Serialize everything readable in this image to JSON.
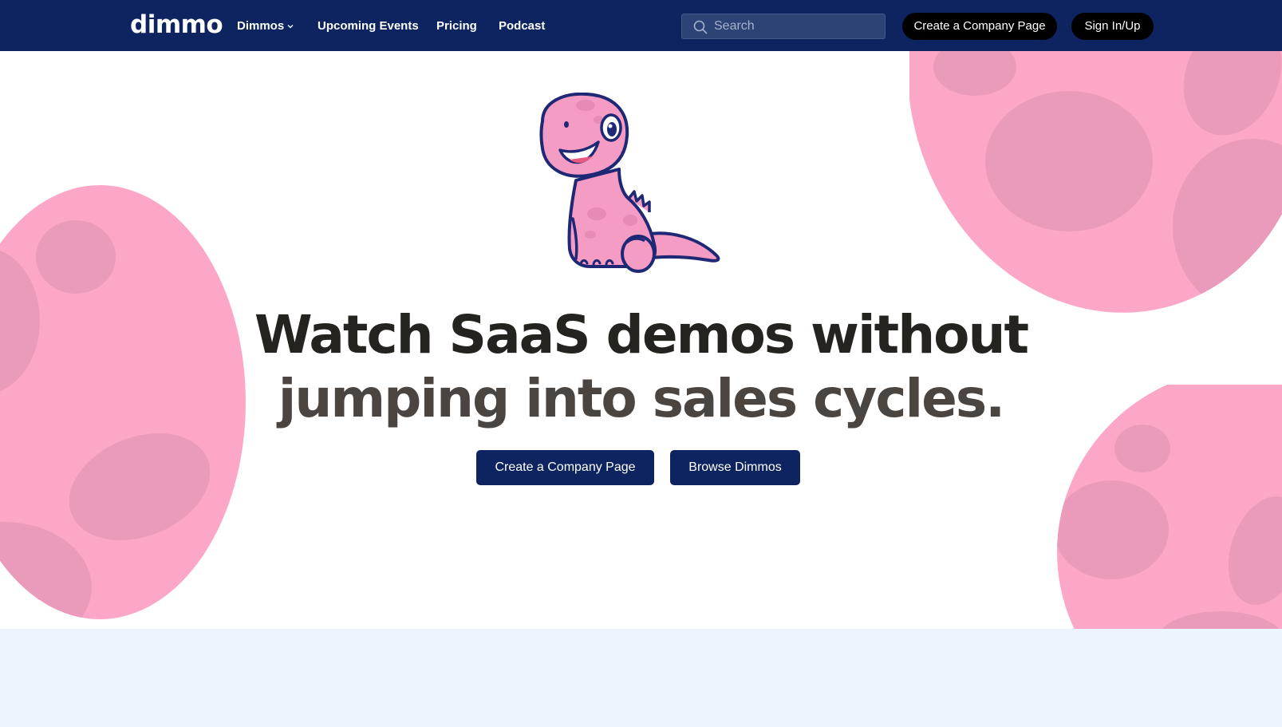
{
  "nav": {
    "logo": "dimmo",
    "links": [
      {
        "label": "Dimmos"
      },
      {
        "label": "Upcoming Events"
      },
      {
        "label": "Pricing"
      },
      {
        "label": "Podcast"
      }
    ],
    "search_placeholder": "Search",
    "create_company_label": "Create a Company Page",
    "sign_in_label": "Sign In/Up"
  },
  "hero": {
    "title_line1": "Watch SaaS demos without",
    "title_line2": "jumping into sales cycles.",
    "primary_cta": "Create a Company Page",
    "secondary_cta": "Browse Dimmos"
  },
  "colors": {
    "nav_bg": "#0d2460",
    "pill_bg": "#000000",
    "cta_bg": "#0d2460",
    "egg_pink": "#fda7c8",
    "egg_spot": "#ea9bbc",
    "lower_band": "#ecf5fd"
  },
  "icons": {
    "search": "search-icon",
    "dropdown": "chevron-down-icon",
    "mascot": "dinosaur-mascot-illustration"
  }
}
